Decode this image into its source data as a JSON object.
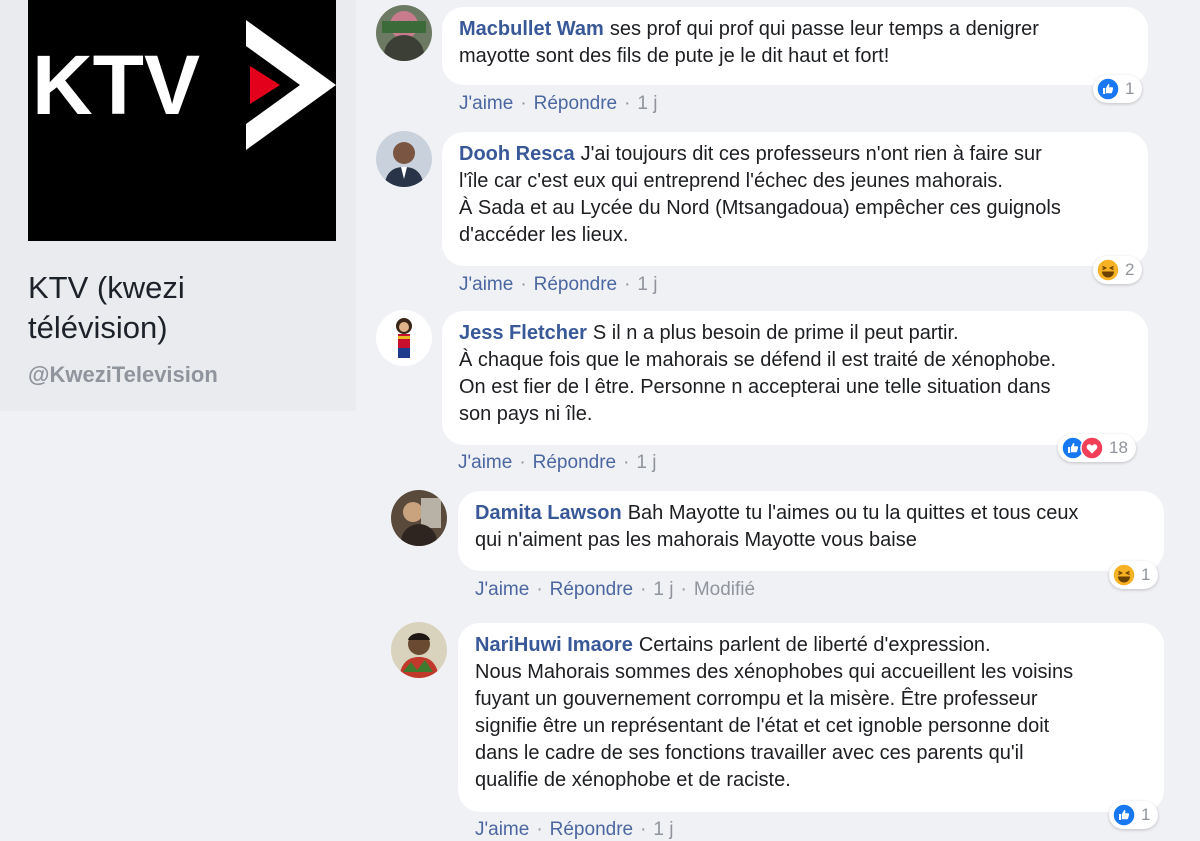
{
  "page": {
    "logo_text": "KTV",
    "name": "KTV (kwezi télévision)",
    "handle": "@KweziTelevision"
  },
  "ui": {
    "like_label": "J'aime",
    "reply_label": "Répondre",
    "separator": "·"
  },
  "comments": [
    {
      "author": "Macbullet Wam",
      "lines": [
        "ses prof qui prof qui passe leur temps a denigrer",
        "mayotte sont des fils de pute je le dit haut et fort!"
      ],
      "time": "1 j",
      "reactions": [
        "like"
      ],
      "reaction_count": "1"
    },
    {
      "author": "Dooh Resca",
      "lines": [
        "J'ai toujours dit ces professeurs n'ont rien à faire sur",
        "l'île car c'est eux qui entreprend l'échec des jeunes mahorais.",
        "À Sada et au Lycée du Nord (Mtsangadoua) empêcher ces guignols",
        "d'accéder les lieux."
      ],
      "time": "1 j",
      "reactions": [
        "haha"
      ],
      "reaction_count": "2"
    },
    {
      "author": "Jess Fletcher",
      "lines": [
        "S il n a plus besoin de prime il peut partir.",
        "À chaque fois que le mahorais se défend il est traité de xénophobe.",
        "On est fier de l être. Personne n accepterai une telle situation dans",
        "son pays ni île."
      ],
      "time": "1 j",
      "reactions": [
        "like",
        "love"
      ],
      "reaction_count": "18"
    },
    {
      "author": "Damita Lawson",
      "lines": [
        "Bah Mayotte tu l'aimes ou tu la quittes et tous ceux",
        "qui n'aiment pas les mahorais Mayotte vous baise"
      ],
      "time": "1 j",
      "edited": "Modifié",
      "reactions": [
        "haha"
      ],
      "reaction_count": "1"
    },
    {
      "author": "NariHuwi Imaore",
      "lines": [
        "Certains parlent de liberté d'expression.",
        "Nous Mahorais sommes des xénophobes qui accueillent les voisins",
        "fuyant un gouvernement corrompu et la misère. Être professeur",
        "signifie être un représentant de l'état et cet ignoble personne doit",
        "dans le cadre de ses fonctions travailler avec ces parents qu'il",
        "qualifie de xénophobe et de raciste."
      ],
      "time": "1 j",
      "reactions": [
        "like"
      ],
      "reaction_count": "1"
    }
  ],
  "colors": {
    "author": "#385898",
    "link": "#4b67a1",
    "muted": "#90949c",
    "like": "#1877f2",
    "love": "#f33e58",
    "haha": "#f7b125"
  }
}
